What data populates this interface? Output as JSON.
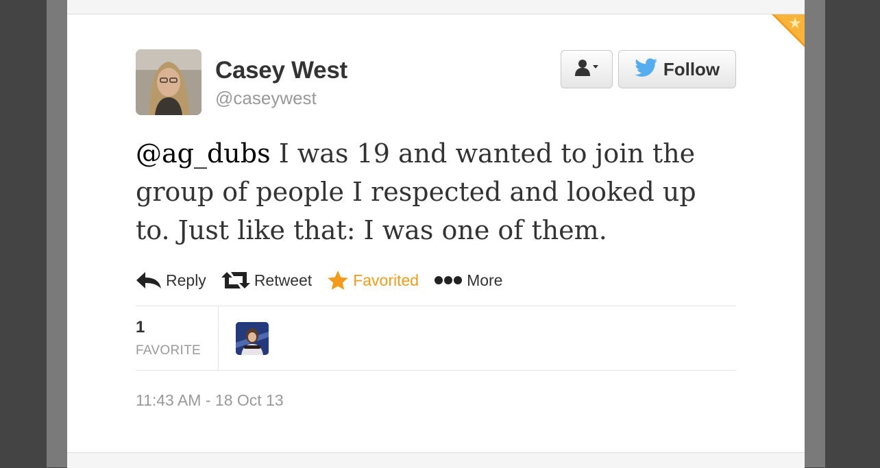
{
  "tweet": {
    "author_name": "Casey West",
    "author_handle": "@caseywest",
    "mention": "@ag_dubs",
    "text_rest": " I was 19 and wanted to join the group of people I respected and looked up to. Just like that: I was one of them.",
    "timestamp": "11:43 AM - 18 Oct 13"
  },
  "buttons": {
    "follow_label": "Follow",
    "user_actions_icon": "user-dropdown-icon"
  },
  "actions": {
    "reply_label": "Reply",
    "retweet_label": "Retweet",
    "favorited_label": "Favorited",
    "more_label": "More"
  },
  "stats": {
    "favorite_count": "1",
    "favorite_label": "FAVORITE"
  },
  "colors": {
    "favorite_accent": "#f29b1d",
    "twitter_blue": "#55acee",
    "text_primary": "#333333",
    "text_muted": "#999999"
  }
}
